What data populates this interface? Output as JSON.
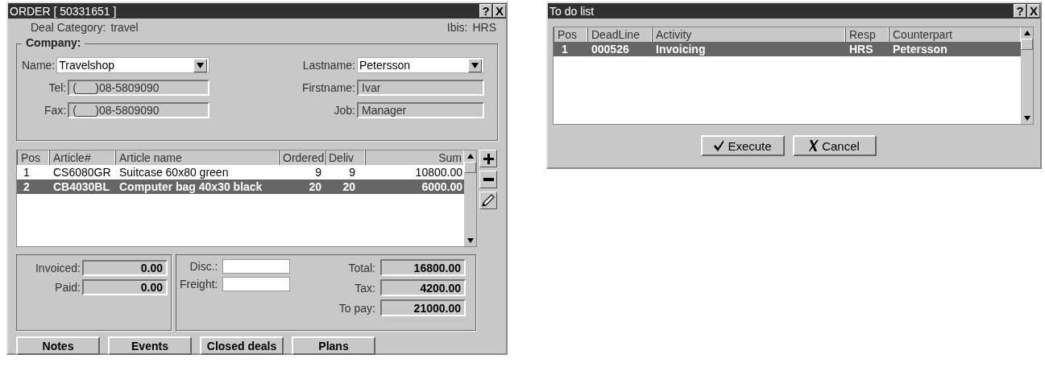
{
  "order_window": {
    "title": "ORDER [ 50331651 ]",
    "help": "?",
    "close": "X",
    "deal_category": {
      "label": "Deal Category:",
      "value": "travel"
    },
    "ibis": {
      "label": "Ibis:",
      "value": "HRS"
    },
    "company": {
      "title": "Company:",
      "left_fields": [
        {
          "label": "Name:",
          "value": "Travelshop",
          "kind": "dropdown"
        },
        {
          "label": "Tel:",
          "value": "(___)08-5809090",
          "kind": "text"
        },
        {
          "label": "Fax:",
          "value": "(___)08-5809090",
          "kind": "text"
        }
      ],
      "right_fields": [
        {
          "label": "Lastname:",
          "value": "Petersson",
          "kind": "dropdown"
        },
        {
          "label": "Firstname:",
          "value": "Ivar",
          "kind": "text"
        },
        {
          "label": "Job:",
          "value": "Manager",
          "kind": "text"
        }
      ]
    },
    "articles": {
      "columns": [
        "Pos",
        "Article#",
        "Article name",
        "Ordered",
        "Deliv",
        "Sum"
      ],
      "rows": [
        {
          "cells": [
            "1",
            "CS6080GR",
            "Suitcase 60x80 green",
            "9",
            "9",
            "10800.00"
          ],
          "selected": false
        },
        {
          "cells": [
            "2",
            "CB4030BL",
            "Computer bag 40x30 black",
            "20",
            "20",
            "6000.00"
          ],
          "selected": true
        }
      ]
    },
    "payments": [
      {
        "label": "Invoiced:",
        "value": "0.00"
      },
      {
        "label": "Paid:",
        "value": "0.00"
      }
    ],
    "totals": [
      {
        "label": "Disc.:",
        "kind": "input"
      },
      {
        "label": "Freight:",
        "kind": "input"
      },
      {
        "label": "Total:",
        "value": "16800.00",
        "kind": "output"
      },
      {
        "label": "Tax:",
        "value": "4200.00",
        "kind": "output"
      },
      {
        "label": "To pay:",
        "value": "21000.00",
        "kind": "output"
      }
    ],
    "buttons": [
      "Notes",
      "Events",
      "Closed deals",
      "Plans"
    ]
  },
  "todo_window": {
    "title": "To do list",
    "help": "?",
    "close": "X",
    "columns": [
      "Pos",
      "DeadLine",
      "Activity",
      "Resp",
      "Counterpart"
    ],
    "rows": [
      {
        "cells": [
          "1",
          "000526",
          "Invoicing",
          "HRS",
          "Petersson"
        ],
        "selected": true
      }
    ],
    "buttons": [
      {
        "label": "Execute",
        "kind": "execute"
      },
      {
        "label": "Cancel",
        "kind": "cancel"
      }
    ]
  }
}
